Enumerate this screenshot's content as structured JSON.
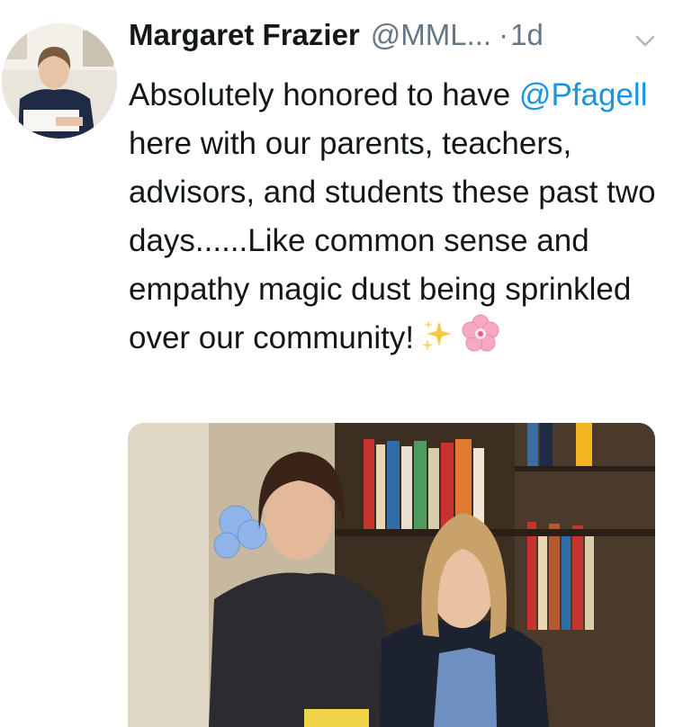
{
  "tweet": {
    "author_name": "Margaret Frazier",
    "author_handle": "@MML...",
    "separator": "·",
    "time": "1d",
    "text_part1": "Absolutely honored to have ",
    "mention": "@Pfagell",
    "text_part2": " here with our parents, teachers, advisors, and students these past two days......Like common sense and empathy magic dust being sprinkled over our community!",
    "emojis": [
      "sparkles-icon",
      "cherry-blossom-icon"
    ],
    "media": {
      "type": "photo"
    }
  },
  "colors": {
    "mention": "#1b95e0",
    "muted": "#657786",
    "text": "#14171a"
  }
}
